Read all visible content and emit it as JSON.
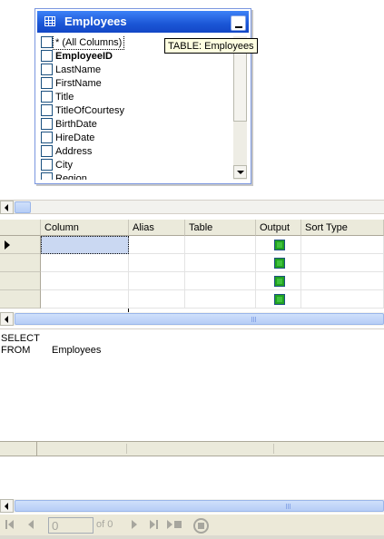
{
  "diagram": {
    "table_title": "Employees",
    "tooltip": "TABLE: Employees",
    "columns": [
      {
        "label": "* (All Columns)",
        "bold": false
      },
      {
        "label": "EmployeeID",
        "bold": true
      },
      {
        "label": "LastName",
        "bold": false
      },
      {
        "label": "FirstName",
        "bold": false
      },
      {
        "label": "Title",
        "bold": false
      },
      {
        "label": "TitleOfCourtesy",
        "bold": false
      },
      {
        "label": "BirthDate",
        "bold": false
      },
      {
        "label": "HireDate",
        "bold": false
      },
      {
        "label": "Address",
        "bold": false
      },
      {
        "label": "City",
        "bold": false
      },
      {
        "label": "Region",
        "bold": false
      }
    ]
  },
  "grid": {
    "headers": [
      "Column",
      "Alias",
      "Table",
      "Output",
      "Sort Type"
    ],
    "row_count": 4
  },
  "sql": {
    "select_keyword": "SELECT",
    "from_keyword": "FROM",
    "from_value": "Employees"
  },
  "navigation": {
    "record_value": "0",
    "record_count": "of 0"
  },
  "colors": {
    "titlebar": "#1b56d6",
    "selection": "#cad8f2",
    "checkbox_checked": "#21a121"
  }
}
